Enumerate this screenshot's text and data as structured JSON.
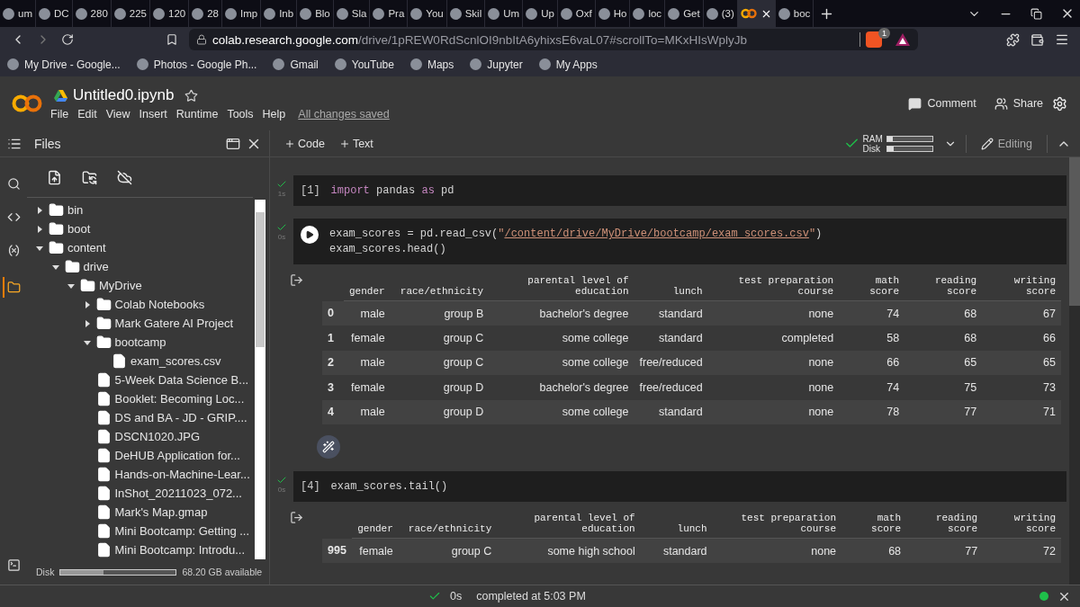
{
  "browser": {
    "tabs": [
      {
        "label": "um",
        "selected": false
      },
      {
        "label": "DC",
        "selected": false
      },
      {
        "label": "280",
        "selected": false
      },
      {
        "label": "225",
        "selected": false
      },
      {
        "label": "120",
        "selected": false
      },
      {
        "label": "28",
        "selected": false
      },
      {
        "label": "Imp",
        "selected": false
      },
      {
        "label": "Inb",
        "selected": false
      },
      {
        "label": "Blo",
        "selected": false
      },
      {
        "label": "Sla",
        "selected": false
      },
      {
        "label": "Pra",
        "selected": false
      },
      {
        "label": "You",
        "selected": false
      },
      {
        "label": "Skil",
        "selected": false
      },
      {
        "label": "Um",
        "selected": false
      },
      {
        "label": "Up",
        "selected": false
      },
      {
        "label": "Oxf",
        "selected": false
      },
      {
        "label": "Ho",
        "selected": false
      },
      {
        "label": "loc",
        "selected": false
      },
      {
        "label": "Get",
        "selected": false
      },
      {
        "label": "(3)",
        "selected": false
      },
      {
        "selected": true
      },
      {
        "label": "boc",
        "selected": false
      }
    ],
    "url": {
      "host": "colab.research.google.com",
      "path": "/drive/1pREW0RdScnlOI9nbItA6yhixsE6vaL07#scrollTo=MKxHIsWplyJb"
    },
    "shield_count": "1",
    "bookmarks": [
      "My Drive - Google...",
      "Photos - Google Ph...",
      "Gmail",
      "YouTube",
      "Maps",
      "Jupyter",
      "My Apps"
    ]
  },
  "header": {
    "title": "Untitled0.ipynb",
    "menu": [
      "File",
      "Edit",
      "View",
      "Insert",
      "Runtime",
      "Tools",
      "Help"
    ],
    "save_status": "All changes saved",
    "actions": [
      "Comment",
      "Share"
    ]
  },
  "toolbar": {
    "panel_title": "Files",
    "insert": [
      "Code",
      "Text"
    ],
    "ram_label": "RAM",
    "ram": {
      "level": 0.12
    },
    "disk_label": "Disk",
    "disk": {
      "level": 0.15
    },
    "mode": "Editing"
  },
  "sidebar": {
    "tree": [
      {
        "name": "bin",
        "kind": "folder",
        "expanded": false
      },
      {
        "name": "boot",
        "kind": "folder",
        "expanded": false
      },
      {
        "name": "content",
        "kind": "folder",
        "expanded": true,
        "children": [
          {
            "name": "drive",
            "kind": "folder",
            "expanded": true,
            "children": [
              {
                "name": "MyDrive",
                "kind": "folder",
                "expanded": true,
                "children": [
                  {
                    "name": "Colab Notebooks",
                    "kind": "folder",
                    "expanded": false
                  },
                  {
                    "name": "Mark Gatere AI Project",
                    "kind": "folder",
                    "expanded": false
                  },
                  {
                    "name": "bootcamp",
                    "kind": "folder",
                    "expanded": true,
                    "children": [
                      {
                        "name": "exam_scores.csv",
                        "kind": "file"
                      }
                    ]
                  },
                  {
                    "name": "5-Week Data Science B...",
                    "kind": "file"
                  },
                  {
                    "name": "Booklet: Becoming Loc...",
                    "kind": "file"
                  },
                  {
                    "name": "DS and BA - JD - GRIP....",
                    "kind": "file"
                  },
                  {
                    "name": "DSCN1020.JPG",
                    "kind": "file"
                  },
                  {
                    "name": "DeHUB Application for...",
                    "kind": "file"
                  },
                  {
                    "name": "Hands-on-Machine-Lear...",
                    "kind": "file"
                  },
                  {
                    "name": "InShot_20211023_072...",
                    "kind": "file"
                  },
                  {
                    "name": "Mark's Map.gmap",
                    "kind": "file"
                  },
                  {
                    "name": "Mini Bootcamp: Getting ...",
                    "kind": "file"
                  },
                  {
                    "name": "Mini Bootcamp: Introdu...",
                    "kind": "file"
                  }
                ]
              }
            ]
          }
        ]
      }
    ],
    "disk_label": "Disk",
    "disk": {
      "level": 0.37
    },
    "disk_available": "68.20 GB available"
  },
  "cells": [
    {
      "kind": "code",
      "count": "[1]",
      "status_time": "1s",
      "lines": [
        [
          {
            "text": "import",
            "kind": "keyword"
          },
          {
            "text": " pandas ",
            "kind": "plain"
          },
          {
            "text": "as",
            "kind": "keyword"
          },
          {
            "text": " pd",
            "kind": "plain"
          }
        ]
      ]
    },
    {
      "kind": "code",
      "status_time": "0s",
      "lines": [
        [
          {
            "text": "exam_scores = pd.read_csv(",
            "kind": "plain"
          },
          {
            "text": "\"",
            "kind": "string"
          },
          {
            "text": "/content/drive/MyDrive/bootcamp/exam_scores.csv",
            "kind": "link"
          },
          {
            "text": "\"",
            "kind": "string"
          },
          {
            "text": ")",
            "kind": "plain"
          }
        ],
        [
          {
            "text": "exam_scores.head()",
            "kind": "plain"
          }
        ]
      ],
      "output": {
        "columns": [
          "gender",
          "race/ethnicity",
          "parental level of\neducation",
          "lunch",
          "test preparation\ncourse",
          "math\nscore",
          "reading\nscore",
          "writing\nscore"
        ],
        "rows": [
          {
            "index": "0",
            "cells": [
              "male",
              "group B",
              "bachelor's degree",
              "standard",
              "none",
              "74",
              "68",
              "67"
            ]
          },
          {
            "index": "1",
            "cells": [
              "female",
              "group C",
              "some college",
              "standard",
              "completed",
              "58",
              "68",
              "66"
            ]
          },
          {
            "index": "2",
            "cells": [
              "male",
              "group C",
              "some college",
              "free/reduced",
              "none",
              "66",
              "65",
              "65"
            ]
          },
          {
            "index": "3",
            "cells": [
              "female",
              "group D",
              "bachelor's degree",
              "free/reduced",
              "none",
              "74",
              "75",
              "73"
            ]
          },
          {
            "index": "4",
            "cells": [
              "male",
              "group D",
              "some college",
              "standard",
              "none",
              "78",
              "77",
              "71"
            ]
          }
        ]
      }
    },
    {
      "kind": "code",
      "count": "[4]",
      "status_time": "0s",
      "lines": [
        [
          {
            "text": "exam_scores.tail()",
            "kind": "plain"
          }
        ]
      ],
      "output": {
        "columns": [
          "gender",
          "race/ethnicity",
          "parental level of\neducation",
          "lunch",
          "test preparation\ncourse",
          "math\nscore",
          "reading\nscore",
          "writing\nscore"
        ],
        "rows": [
          {
            "index": "995",
            "cells": [
              "female",
              "group C",
              "some high school",
              "standard",
              "none",
              "68",
              "77",
              "72"
            ]
          }
        ]
      }
    }
  ],
  "status_bar": {
    "time": "0s",
    "message": "completed at 5:03 PM"
  }
}
